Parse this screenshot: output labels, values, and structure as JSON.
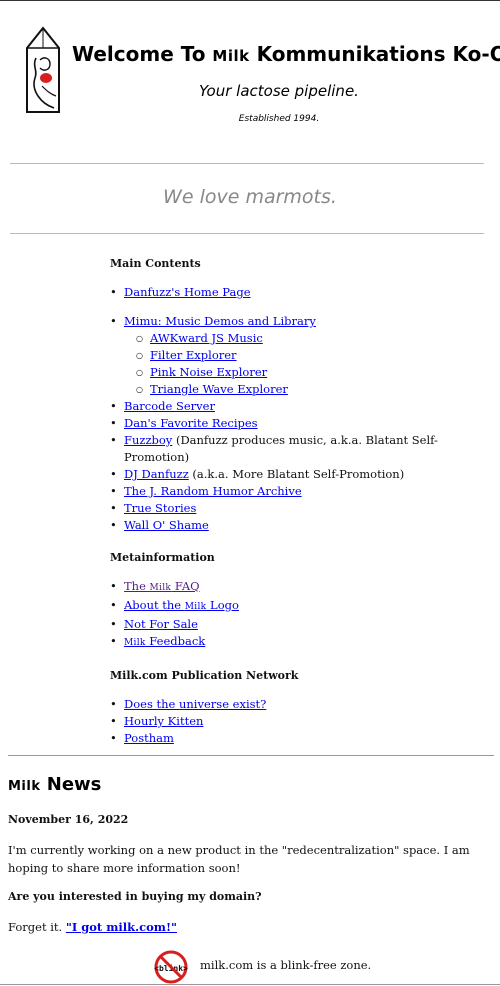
{
  "header": {
    "title_pre": "Welcome To ",
    "title_brand": "Milk",
    "title_post": " Kommunikations Ko-Op",
    "tagline": "Your lactose pipeline.",
    "established": "Established 1994."
  },
  "banner": "We love marmots.",
  "main_contents": {
    "heading": "Main Contents",
    "home": "Danfuzz's Home Page",
    "mimu": "Mimu: Music Demos and Library",
    "mimu_items": [
      "AWKward JS Music",
      "Filter Explorer",
      "Pink Noise Explorer",
      "Triangle Wave Explorer"
    ],
    "barcode": "Barcode Server",
    "recipes": "Dan's Favorite Recipes",
    "fuzzboy": "Fuzzboy",
    "fuzzboy_note": " (Danfuzz produces music, a.k.a. Blatant Self-Promotion)",
    "djdanfuzz": "DJ Danfuzz",
    "djdanfuzz_note": " (a.k.a. More Blatant Self-Promotion)",
    "humor": "The J. Random Humor Archive",
    "true_stories": "True Stories",
    "wall": "Wall O' Shame"
  },
  "metainformation": {
    "heading": "Metainformation",
    "faq_pre": "The ",
    "faq_brand": "Milk",
    "faq_post": " FAQ",
    "logo_pre": "About the ",
    "logo_brand": "Milk",
    "logo_post": " Logo",
    "not_for_sale": "Not For Sale",
    "feedback_brand": "Milk",
    "feedback_post": " Feedback"
  },
  "publication_network": {
    "heading": "Milk.com Publication Network",
    "items": [
      "Does the universe exist?",
      "Hourly Kitten",
      "Postham"
    ]
  },
  "news": {
    "title_brand": "Milk",
    "title_post": " News",
    "date": "November 16, 2022",
    "text": "I'm currently working on a new product in the \"redecentralization\" space. I am hoping to share more information soon!",
    "question": "Are you interested in buying my domain?",
    "forget": "Forget it. ",
    "link": "\"I got milk.com!\""
  },
  "blink": {
    "icon_text": "<blink>",
    "text": "milk.com is a blink-free zone."
  }
}
